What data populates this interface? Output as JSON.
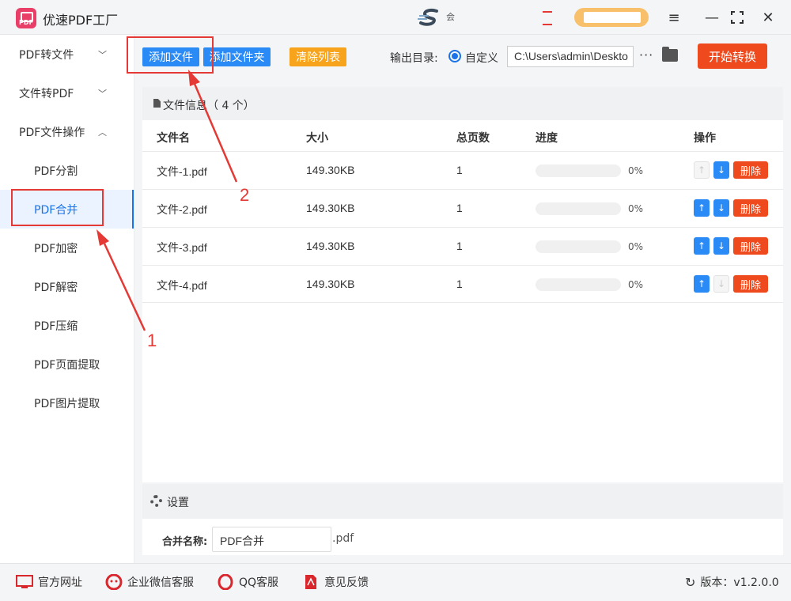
{
  "app": {
    "title": "优速PDF工厂",
    "logo_text": "PDF",
    "center_logo_text": "会"
  },
  "sidebar": {
    "groups": [
      {
        "label": "PDF转文件",
        "chevron": "down"
      },
      {
        "label": "文件转PDF",
        "chevron": "down"
      },
      {
        "label": "PDF文件操作",
        "chevron": "up"
      }
    ],
    "sub_items": [
      "PDF分割",
      "PDF合并",
      "PDF加密",
      "PDF解密",
      "PDF压缩",
      "PDF页面提取",
      "PDF图片提取"
    ],
    "active_item": "PDF合并"
  },
  "toolbar": {
    "add_file": "添加文件",
    "add_folder": "添加文件夹",
    "clear_list": "清除列表",
    "output_label": "输出目录:",
    "radio_label": "自定义",
    "output_path": "C:\\Users\\admin\\Deskto",
    "more": "···",
    "start": "开始转换"
  },
  "file_panel": {
    "title": "文件信息（ 4 个）",
    "columns": [
      "文件名",
      "大小",
      "总页数",
      "进度",
      "操作"
    ],
    "rows": [
      {
        "name": "文件-1.pdf",
        "size": "149.30KB",
        "pages": "1",
        "progress": "0%",
        "up_enabled": false,
        "down_enabled": true
      },
      {
        "name": "文件-2.pdf",
        "size": "149.30KB",
        "pages": "1",
        "progress": "0%",
        "up_enabled": true,
        "down_enabled": true
      },
      {
        "name": "文件-3.pdf",
        "size": "149.30KB",
        "pages": "1",
        "progress": "0%",
        "up_enabled": true,
        "down_enabled": true
      },
      {
        "name": "文件-4.pdf",
        "size": "149.30KB",
        "pages": "1",
        "progress": "0%",
        "up_enabled": true,
        "down_enabled": false
      }
    ],
    "delete_label": "删除"
  },
  "settings": {
    "title": "设置",
    "merge_label": "合并名称:",
    "merge_value": "PDF合并",
    "merge_ext": ".pdf"
  },
  "footer": {
    "items": [
      "官方网址",
      "企业微信客服",
      "QQ客服",
      "意见反馈"
    ],
    "version": "版本：v1.2.0.0"
  },
  "annotations": {
    "step1": "1",
    "step2": "2"
  },
  "colors": {
    "accent_blue": "#2a8af6",
    "delete_red": "#ef4a1e",
    "clear_orange": "#f7a31c",
    "annotation_red": "#e53935"
  }
}
